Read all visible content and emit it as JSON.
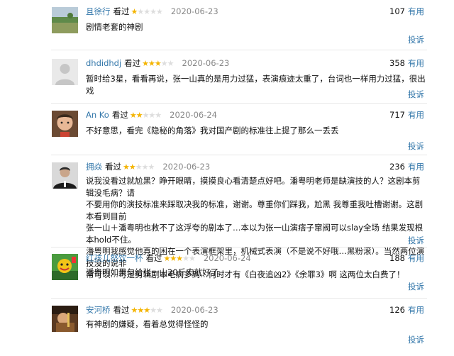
{
  "comments": [
    {
      "user": "且徐行",
      "watched": "看过",
      "rating": 1,
      "date": "2020-06-23",
      "votes": "107",
      "vote_label": "有用",
      "report_label": "投诉",
      "lines": [
        "剧情老套的神剧"
      ]
    },
    {
      "user": "dhdidhdj",
      "watched": "看过",
      "rating": 3,
      "date": "2020-06-23",
      "votes": "358",
      "vote_label": "有用",
      "report_label": "投诉",
      "lines": [
        "暂时给3星，看看再说，张一山真的是用力过猛，表演痕迹太重了，台词也一样用力过猛，很出戏"
      ]
    },
    {
      "user": "An Ko",
      "watched": "看过",
      "rating": 2,
      "date": "2020-06-24",
      "votes": "717",
      "vote_label": "有用",
      "report_label": "投诉",
      "lines": [
        "不好意思，看完《隐秘的角落》我对国产剧的标准往上提了那么一丢丢"
      ]
    },
    {
      "user": "拥焱",
      "watched": "看过",
      "rating": 2,
      "date": "2020-06-23",
      "votes": "236",
      "vote_label": "有用",
      "report_label": "投诉",
      "lines": [
        "说我没看过就尬黑？睁开眼睛，摸摸良心看清楚点好吧。潘粤明老师是缺演技的人？这剧本剪辑没毛病？请",
        "不要用你的演技标准来踩取决我的标准，谢谢。尊重你们踩我，尬黑 我尊重我吐槽谢谢。这剧本看到目前",
        "张一山＋潘粤明也救不了这浮夸的剧本了…本以为张一山演痞子窜阀可以slay全场 结果发现根本hold不住。",
        "潘粤明我感觉他真的困在一个表演框架里，机械式表演（不是说不好哦…黑粉滚）。当然两位演技没的说非",
        "常可以…可是剪辑剧本毛病多到…何时才有《白夜追凶2》《余罪3》啊 这两位太白费了！"
      ]
    },
    {
      "user": "红孩儿怒饮一杯",
      "watched": "看过",
      "rating": 3,
      "date": "2020-06-24",
      "votes": "188",
      "vote_label": "有用",
      "report_label": "投诉",
      "lines": [
        "潘粤明如果匀给张一山20斤肉就好了…"
      ]
    },
    {
      "user": "安河桥",
      "watched": "看过",
      "rating": 3,
      "date": "2020-06-23",
      "votes": "126",
      "vote_label": "有用",
      "report_label": "投诉",
      "lines": [
        "有神剧的嫌疑，看着总觉得怪怪的"
      ]
    }
  ]
}
